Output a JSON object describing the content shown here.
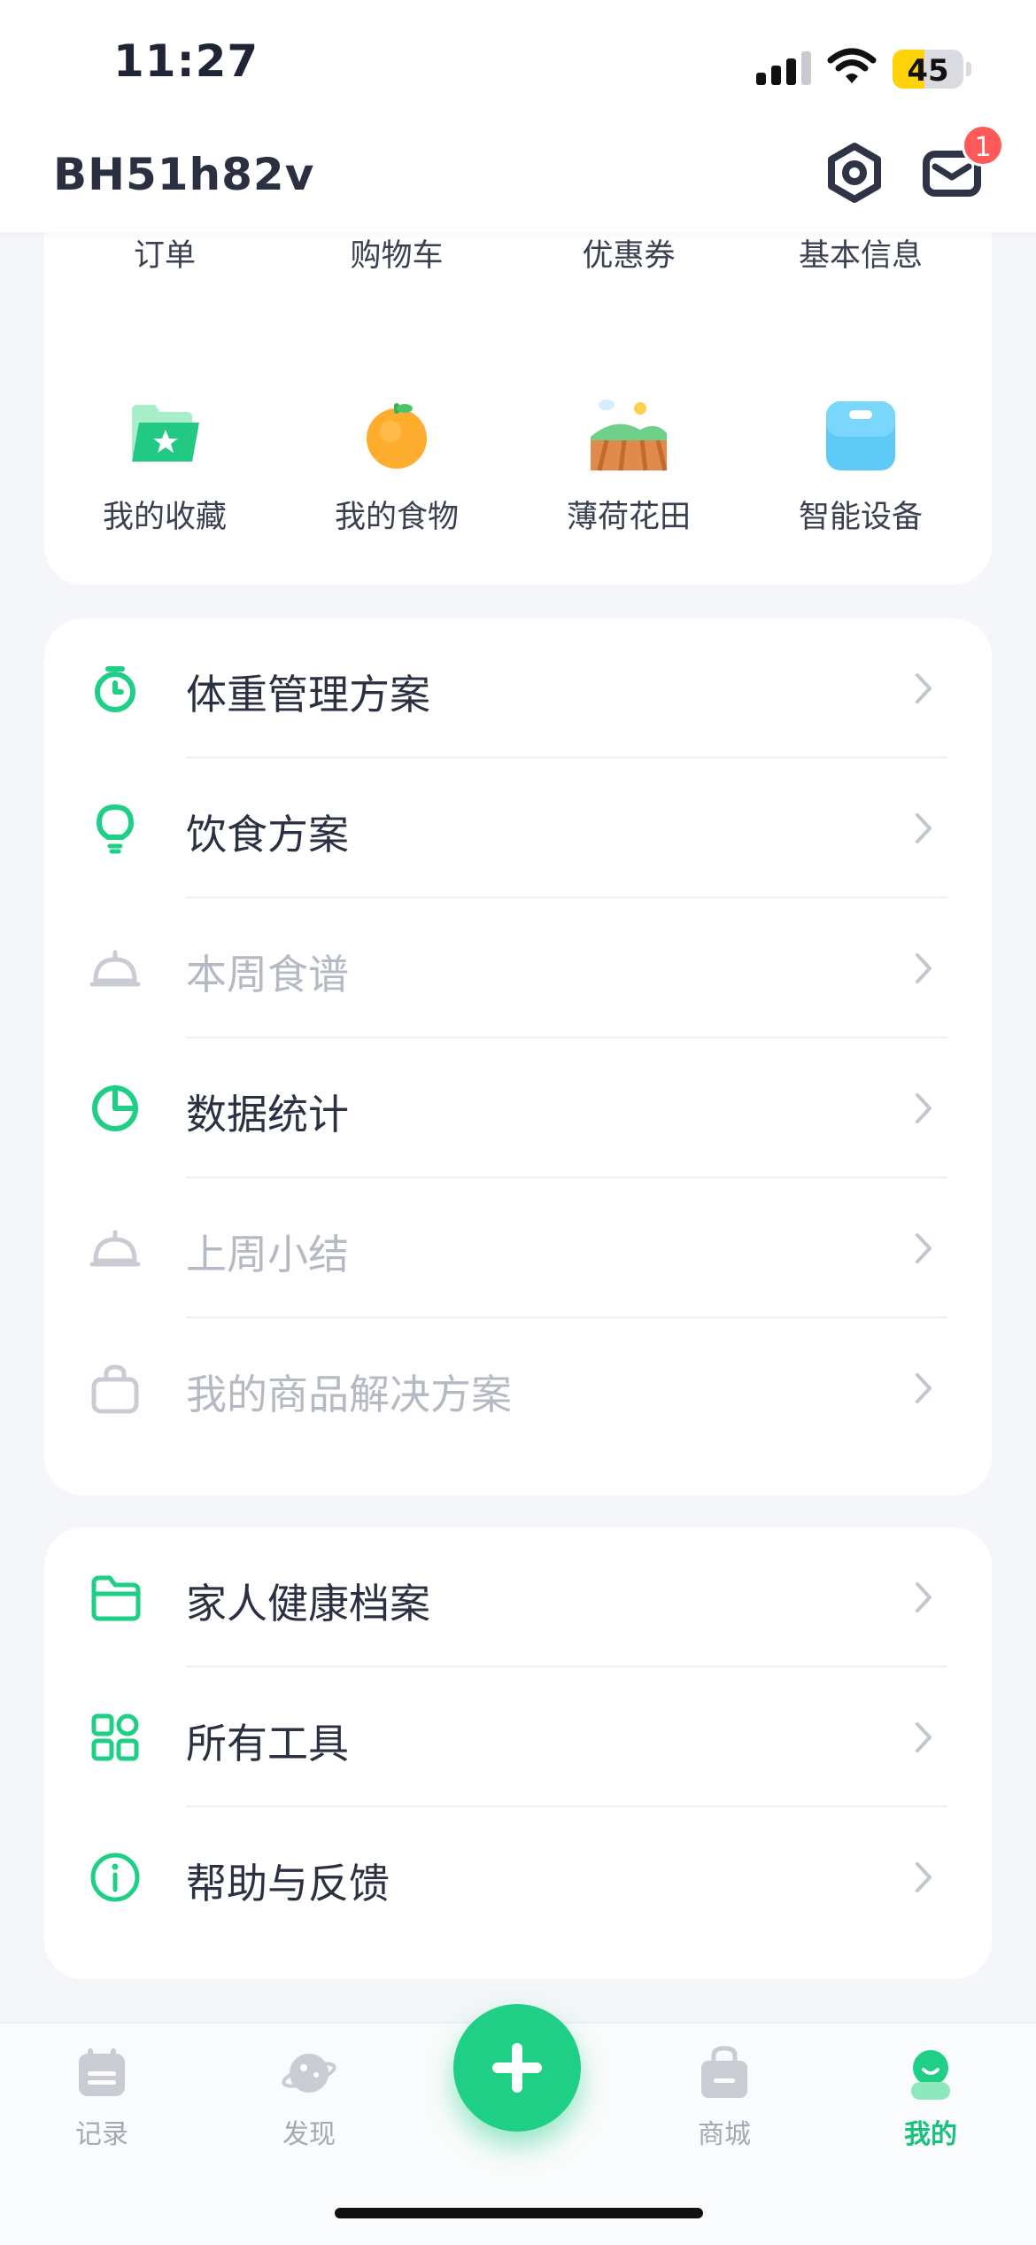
{
  "status_bar": {
    "time": "11:27",
    "battery": "45",
    "battery_level": 0.45
  },
  "header": {
    "username": "BH51h82v",
    "unread_count": "1"
  },
  "quick_grid": [
    {
      "label": "订单",
      "icon": "order-icon"
    },
    {
      "label": "购物车",
      "icon": "cart-icon"
    },
    {
      "label": "优惠券",
      "icon": "coupon-icon"
    },
    {
      "label": "基本信息",
      "icon": "profile-info-icon"
    },
    {
      "label": "我的收藏",
      "icon": "favorites-folder-icon"
    },
    {
      "label": "我的食物",
      "icon": "orange-icon"
    },
    {
      "label": "薄荷花田",
      "icon": "farm-field-icon"
    },
    {
      "label": "智能设备",
      "icon": "smart-scale-icon"
    }
  ],
  "plan_menu": [
    {
      "label": "体重管理方案",
      "icon": "stopwatch-icon",
      "enabled": true
    },
    {
      "label": "饮食方案",
      "icon": "lightbulb-icon",
      "enabled": true
    },
    {
      "label": "本周食谱",
      "icon": "cloche-icon",
      "enabled": false
    },
    {
      "label": "数据统计",
      "icon": "pie-chart-icon",
      "enabled": true
    },
    {
      "label": "上周小结",
      "icon": "cloche-icon",
      "enabled": false
    },
    {
      "label": "我的商品解决方案",
      "icon": "shopping-bag-icon",
      "enabled": false
    }
  ],
  "misc_menu": [
    {
      "label": "家人健康档案",
      "icon": "folder-icon"
    },
    {
      "label": "所有工具",
      "icon": "apps-grid-icon"
    },
    {
      "label": "帮助与反馈",
      "icon": "info-icon"
    }
  ],
  "tabbar": [
    {
      "label": "记录",
      "icon": "calendar-icon",
      "active": false
    },
    {
      "label": "发现",
      "icon": "planet-icon",
      "active": false
    },
    {
      "label": "商城",
      "icon": "shop-bag-icon",
      "active": false
    },
    {
      "label": "我的",
      "icon": "avatar-icon",
      "active": true
    }
  ],
  "colors": {
    "accent": "#1fcf85",
    "badge": "#ff5a5a",
    "disabled_text": "#b5b9c3"
  }
}
